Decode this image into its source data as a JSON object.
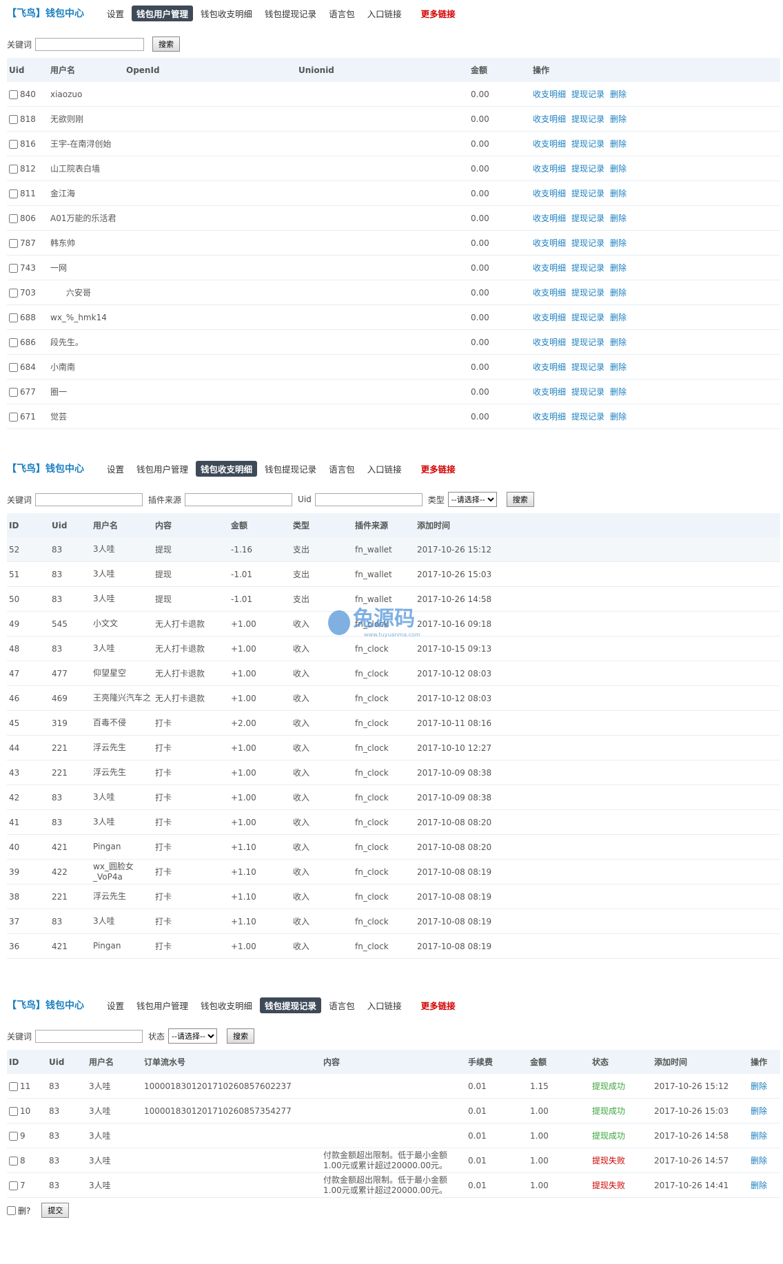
{
  "brand": "【飞鸟】钱包中心",
  "nav": [
    "设置",
    "钱包用户管理",
    "钱包收支明细",
    "钱包提现记录",
    "语言包",
    "入口链接"
  ],
  "nav_more": "更多链接",
  "panel1": {
    "active": 1,
    "keyword_label": "关键词",
    "search_btn": "搜索",
    "headers": [
      "Uid",
      "用户名",
      "OpenId",
      "Unionid",
      "金额",
      "操作"
    ],
    "actions": [
      "收支明细",
      "提现记录",
      "删除"
    ],
    "rows": [
      [
        "840",
        "xiaozuo",
        "0.00"
      ],
      [
        "818",
        "无欲则刚",
        "0.00"
      ],
      [
        "816",
        "王宇-在南浔创始",
        "0.00"
      ],
      [
        "812",
        "山工院表白墙",
        "0.00"
      ],
      [
        "811",
        "金江海",
        "0.00"
      ],
      [
        "806",
        "A01万能的乐活君",
        "0.00"
      ],
      [
        "787",
        "韩东帅",
        "0.00"
      ],
      [
        "743",
        "一网",
        "0.00"
      ],
      [
        "703",
        "      六安哥",
        "0.00"
      ],
      [
        "688",
        "wx_%_hmk14",
        "0.00"
      ],
      [
        "686",
        "段先生。",
        "0.00"
      ],
      [
        "684",
        "小南南",
        "0.00"
      ],
      [
        "677",
        "圈一",
        "0.00"
      ],
      [
        "671",
        "觉芸",
        "0.00"
      ]
    ]
  },
  "panel2": {
    "active": 2,
    "keyword_label": "关键词",
    "source_label": "插件来源",
    "uid_label": "Uid",
    "type_label": "类型",
    "type_select": "--请选择--",
    "search_btn": "搜索",
    "headers": [
      "ID",
      "Uid",
      "用户名",
      "内容",
      "金额",
      "类型",
      "插件来源",
      "添加时间"
    ],
    "rows": [
      [
        "52",
        "83",
        "3人哇",
        "提现",
        "-1.16",
        "支出",
        "fn_wallet",
        "2017-10-26 15:12"
      ],
      [
        "51",
        "83",
        "3人哇",
        "提现",
        "-1.01",
        "支出",
        "fn_wallet",
        "2017-10-26 15:03"
      ],
      [
        "50",
        "83",
        "3人哇",
        "提现",
        "-1.01",
        "支出",
        "fn_wallet",
        "2017-10-26 14:58"
      ],
      [
        "49",
        "545",
        "小文文",
        "无人打卡退款",
        "+1.00",
        "收入",
        "fn_clock",
        "2017-10-16 09:18"
      ],
      [
        "48",
        "83",
        "3人哇",
        "无人打卡退款",
        "+1.00",
        "收入",
        "fn_clock",
        "2017-10-15 09:13"
      ],
      [
        "47",
        "477",
        "仰望星空",
        "无人打卡退款",
        "+1.00",
        "收入",
        "fn_clock",
        "2017-10-12 08:03"
      ],
      [
        "46",
        "469",
        "王亮隆兴汽车之",
        "无人打卡退款",
        "+1.00",
        "收入",
        "fn_clock",
        "2017-10-12 08:03"
      ],
      [
        "45",
        "319",
        "百毒不侵",
        "打卡",
        "+2.00",
        "收入",
        "fn_clock",
        "2017-10-11 08:16"
      ],
      [
        "44",
        "221",
        "浮云先生",
        "打卡",
        "+1.00",
        "收入",
        "fn_clock",
        "2017-10-10 12:27"
      ],
      [
        "43",
        "221",
        "浮云先生",
        "打卡",
        "+1.00",
        "收入",
        "fn_clock",
        "2017-10-09 08:38"
      ],
      [
        "42",
        "83",
        "3人哇",
        "打卡",
        "+1.00",
        "收入",
        "fn_clock",
        "2017-10-09 08:38"
      ],
      [
        "41",
        "83",
        "3人哇",
        "打卡",
        "+1.00",
        "收入",
        "fn_clock",
        "2017-10-08 08:20"
      ],
      [
        "40",
        "421",
        "Pingan",
        "打卡",
        "+1.10",
        "收入",
        "fn_clock",
        "2017-10-08 08:20"
      ],
      [
        "39",
        "422",
        "wx_圆脸女_VoP4a",
        "打卡",
        "+1.10",
        "收入",
        "fn_clock",
        "2017-10-08 08:19"
      ],
      [
        "38",
        "221",
        "浮云先生",
        "打卡",
        "+1.10",
        "收入",
        "fn_clock",
        "2017-10-08 08:19"
      ],
      [
        "37",
        "83",
        "3人哇",
        "打卡",
        "+1.10",
        "收入",
        "fn_clock",
        "2017-10-08 08:19"
      ],
      [
        "36",
        "421",
        "Pingan",
        "打卡",
        "+1.00",
        "收入",
        "fn_clock",
        "2017-10-08 08:19"
      ]
    ]
  },
  "panel3": {
    "active": 3,
    "keyword_label": "关键词",
    "status_label": "状态",
    "status_select": "--请选择--",
    "search_btn": "搜索",
    "headers": [
      "ID",
      "Uid",
      "用户名",
      "订单流水号",
      "内容",
      "手续费",
      "金额",
      "状态",
      "添加时间",
      "操作"
    ],
    "rows": [
      [
        "11",
        "83",
        "3人哇",
        "100001830120171026085760223​7",
        "",
        "0.01",
        "1.15",
        "提现成功",
        "2017-10-26 15:12",
        "ok"
      ],
      [
        "10",
        "83",
        "3人哇",
        "1000018301201710260857354277",
        "",
        "0.01",
        "1.00",
        "提现成功",
        "2017-10-26 15:03",
        "ok"
      ],
      [
        "9",
        "83",
        "3人哇",
        "",
        "",
        "0.01",
        "1.00",
        "提现成功",
        "2017-10-26 14:58",
        "ok"
      ],
      [
        "8",
        "83",
        "3人哇",
        "",
        "付款金额超出限制。低于最小金额1.00元或累计超过20000.00元。",
        "0.01",
        "1.00",
        "提现失败",
        "2017-10-26 14:57",
        "fail"
      ],
      [
        "7",
        "83",
        "3人哇",
        "",
        "付款金额超出限制。低于最小金额1.00元或累计超过20000.00元。",
        "0.01",
        "1.00",
        "提现失败",
        "2017-10-26 14:41",
        "fail"
      ]
    ],
    "delete_label": "删除",
    "footer_delete_label": "删?",
    "submit_btn": "提交"
  },
  "watermark": {
    "text": "兔源码",
    "sub": "www.tuyuanma.com"
  },
  "colors": {
    "brand": "#1a7fc1",
    "active_tab": "#3e4a58",
    "more": "#d40000",
    "success": "#3aa63a",
    "fail": "#d00000"
  }
}
